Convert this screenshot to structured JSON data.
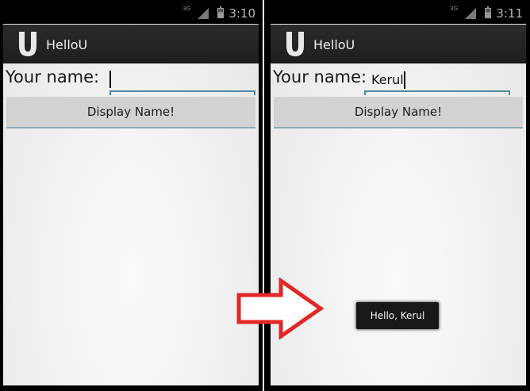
{
  "colors": {
    "accent": "#4a8ba0",
    "arrow": "#e32626",
    "toast_bg": "#181818",
    "button_bg": "#d2d2d2"
  },
  "before": {
    "status": {
      "network": "3G",
      "time": "3:10"
    },
    "app": {
      "icon": "u-logo-icon",
      "title": "HelloU"
    },
    "form": {
      "label": "Your name:",
      "input_value": "",
      "button_label": "Display Name!"
    }
  },
  "after": {
    "status": {
      "network": "3G",
      "time": "3:11"
    },
    "app": {
      "icon": "u-logo-icon",
      "title": "HelloU"
    },
    "form": {
      "label": "Your name:",
      "input_value": "Kerul",
      "button_label": "Display Name!"
    },
    "toast": {
      "text": "Hello, Kerul"
    }
  },
  "transition": {
    "icon": "right-arrow-icon"
  }
}
